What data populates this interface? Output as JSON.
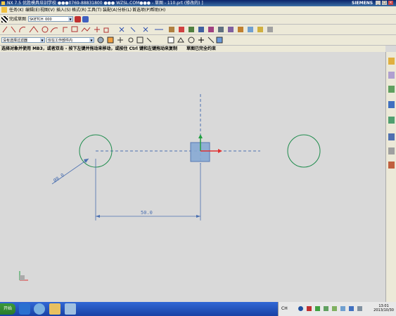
{
  "window": {
    "title": "NX 7.5 优胜模具培训学校  ●●●0769-88831800  ●●● WZSL.COM●●● - 草图 - 110.prt (修改的) ]",
    "brand": "SIEMENS",
    "controls": [
      "_",
      "□",
      "×"
    ]
  },
  "menu": {
    "items": [
      "任务(K)",
      "编辑(E)",
      "视图(V)",
      "插入(S)",
      "格式(R)",
      "工具(T)",
      "装配(A)",
      "分析(L)",
      "首选项(P)",
      "帮助(H)"
    ]
  },
  "toolbar": {
    "finish_sketch_label": "完成草图",
    "sketch_name": "SKETCH_000",
    "selection_filter": "没有选择过滤器",
    "scope": "仅在工作部件内"
  },
  "status": {
    "prompt": "选择对象并使用 MB3，或者双击 - 按下左键并拖动来移动，或按住 Ctrl 键和左键拖动来复制",
    "constraint_msg": "草图已完全约束"
  },
  "sketch": {
    "diameter_dim": "Ø8.0",
    "linear_dim": "50.0"
  },
  "taskbar": {
    "start_label": "开始",
    "tray_prefix": "CH",
    "time": "13:01",
    "date": "2013/10/30"
  },
  "colors": {
    "circle": "#1f8c4d",
    "dimension": "#4a6fb0",
    "datum_fill": "#88aad4",
    "axis_x": "#e03030",
    "axis_y": "#20a040"
  }
}
